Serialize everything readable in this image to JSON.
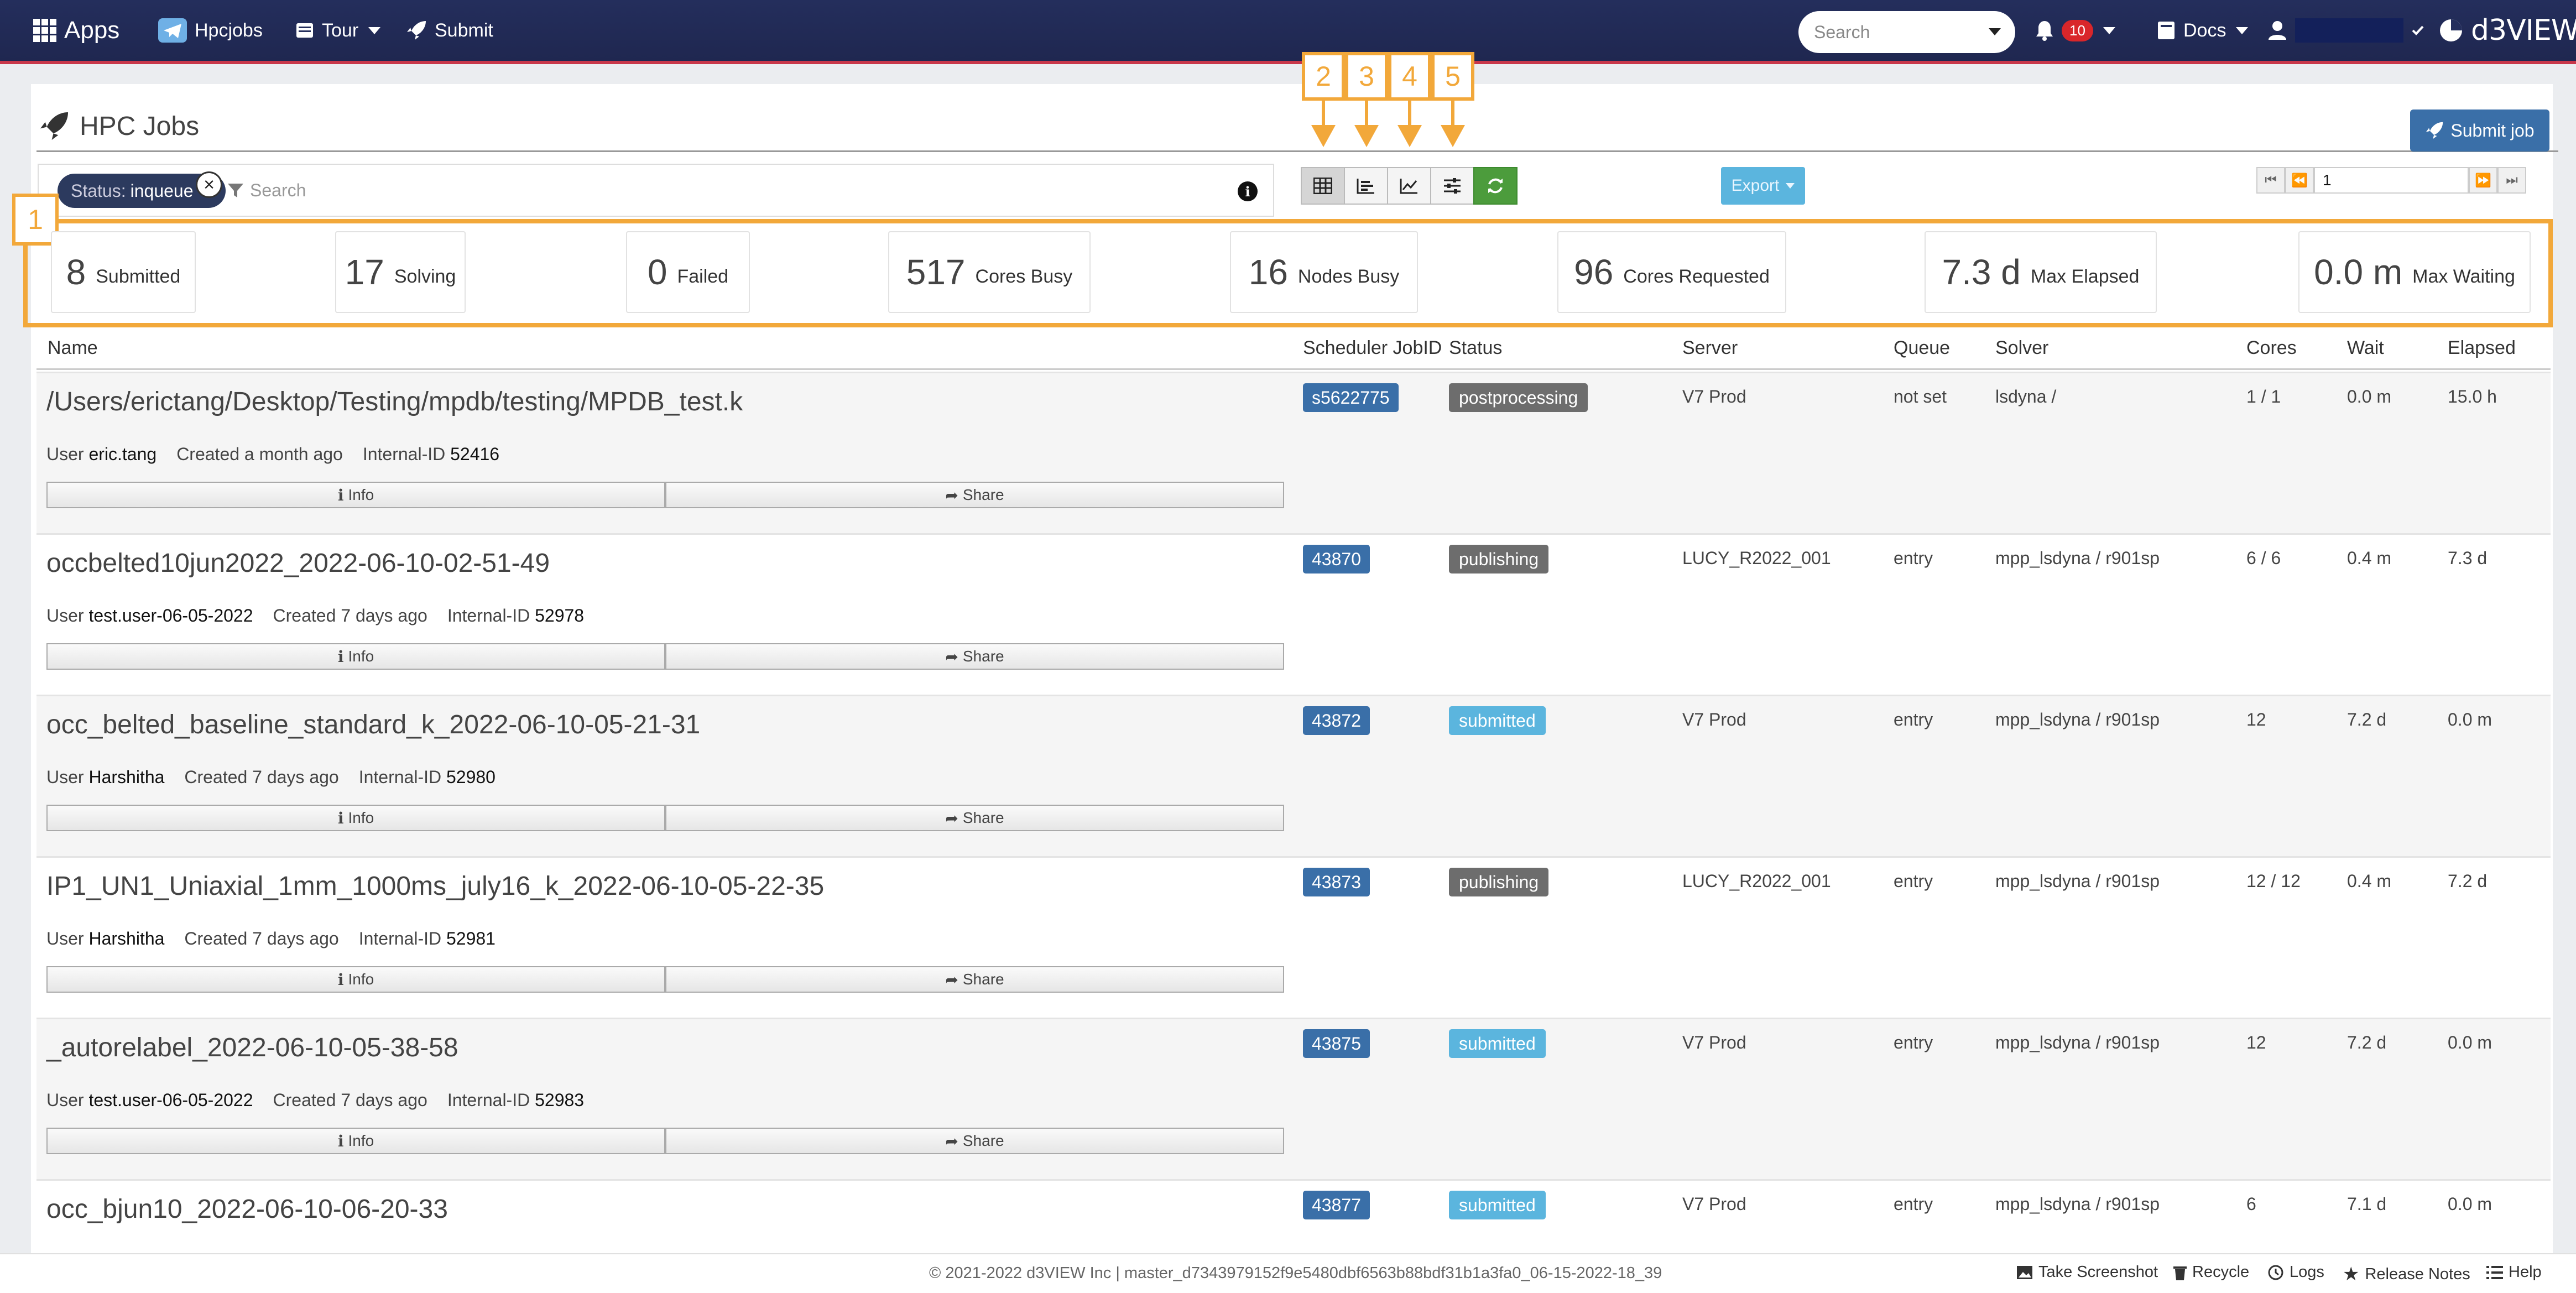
{
  "nav": {
    "apps_label": "Apps",
    "hpcjobs_label": "Hpcjobs",
    "tour_label": "Tour",
    "submit_label": "Submit",
    "search_placeholder": "Search",
    "notifications_count": "10",
    "docs_label": "Docs",
    "logo_text": "d3VIEW"
  },
  "page": {
    "title": "HPC Jobs",
    "submit_job_label": "Submit job"
  },
  "filter": {
    "chip_key": "Status:",
    "chip_value": "inqueue",
    "search_placeholder": "Search"
  },
  "toolbar": {
    "export_label": "Export",
    "page_number": "1"
  },
  "annotations": {
    "stats_marker": "1",
    "view_markers": [
      "2",
      "3",
      "4",
      "5"
    ]
  },
  "stats": [
    {
      "value": "8",
      "label": "Submitted"
    },
    {
      "value": "17",
      "label": "Solving"
    },
    {
      "value": "0",
      "label": "Failed"
    },
    {
      "value": "517",
      "label": "Cores Busy"
    },
    {
      "value": "16",
      "label": "Nodes Busy"
    },
    {
      "value": "96",
      "label": "Cores Requested"
    },
    {
      "value": "7.3 d",
      "label": "Max Elapsed"
    },
    {
      "value": "0.0 m",
      "label": "Max Waiting"
    }
  ],
  "table": {
    "headers": [
      "Name",
      "Scheduler JobID",
      "Status",
      "Server",
      "Queue",
      "Solver",
      "Cores",
      "Wait",
      "Elapsed"
    ],
    "meta_labels": {
      "user": "User",
      "internal": "Internal-ID"
    },
    "info_label": "Info",
    "share_label": "Share",
    "rows": [
      {
        "name": "/Users/erictang/Desktop/Testing/mpdb/testing/MPDB_test.k",
        "user": "eric.tang",
        "created": "Created a month ago",
        "internal_id": "52416",
        "jobid": "s5622775",
        "status": "postprocessing",
        "server": "V7 Prod",
        "queue": "not set",
        "solver": "lsdyna /",
        "cores": "1 / 1",
        "wait": "0.0 m",
        "elapsed": "15.0 h"
      },
      {
        "name": "occbelted10jun2022_2022-06-10-02-51-49",
        "user": "test.user-06-05-2022",
        "created": "Created 7 days ago",
        "internal_id": "52978",
        "jobid": "43870",
        "status": "publishing",
        "server": "LUCY_R2022_001",
        "queue": "entry",
        "solver": "mpp_lsdyna / r901sp",
        "cores": "6 / 6",
        "wait": "0.4 m",
        "elapsed": "7.3 d"
      },
      {
        "name": "occ_belted_baseline_standard_k_2022-06-10-05-21-31",
        "user": "Harshitha",
        "created": "Created 7 days ago",
        "internal_id": "52980",
        "jobid": "43872",
        "status": "submitted",
        "server": "V7 Prod",
        "queue": "entry",
        "solver": "mpp_lsdyna / r901sp",
        "cores": "12",
        "wait": "7.2 d",
        "elapsed": "0.0 m"
      },
      {
        "name": "IP1_UN1_Uniaxial_1mm_1000ms_july16_k_2022-06-10-05-22-35",
        "user": "Harshitha",
        "created": "Created 7 days ago",
        "internal_id": "52981",
        "jobid": "43873",
        "status": "publishing",
        "server": "LUCY_R2022_001",
        "queue": "entry",
        "solver": "mpp_lsdyna / r901sp",
        "cores": "12 / 12",
        "wait": "0.4 m",
        "elapsed": "7.2 d"
      },
      {
        "name": "_autorelabel_2022-06-10-05-38-58",
        "user": "test.user-06-05-2022",
        "created": "Created 7 days ago",
        "internal_id": "52983",
        "jobid": "43875",
        "status": "submitted",
        "server": "V7 Prod",
        "queue": "entry",
        "solver": "mpp_lsdyna / r901sp",
        "cores": "12",
        "wait": "7.2 d",
        "elapsed": "0.0 m"
      },
      {
        "name": "occ_bjun10_2022-06-10-06-20-33",
        "jobid": "43877",
        "status": "submitted",
        "server": "V7 Prod",
        "queue": "entry",
        "solver": "mpp_lsdyna / r901sp",
        "cores": "6",
        "wait": "7.1 d",
        "elapsed": "0.0 m"
      }
    ]
  },
  "footer": {
    "copyright": "© 2021-2022 d3VIEW Inc | master_d7343979152f9e5480dbf6563b88bdf31b1a3fa0_06-15-2022-18_39",
    "screenshot": "Take Screenshot",
    "recycle": "Recycle",
    "logs": "Logs",
    "release_notes": "Release Notes",
    "help": "Help"
  },
  "colors": {
    "navbar": "#242e5c",
    "accent_red": "#c8374a",
    "primary_blue": "#3a6fa8",
    "status_grey": "#6d6d6d",
    "status_lightblue": "#5bb5de",
    "annotation_orange": "#f2a83a",
    "refresh_green": "#4c9c3c"
  }
}
